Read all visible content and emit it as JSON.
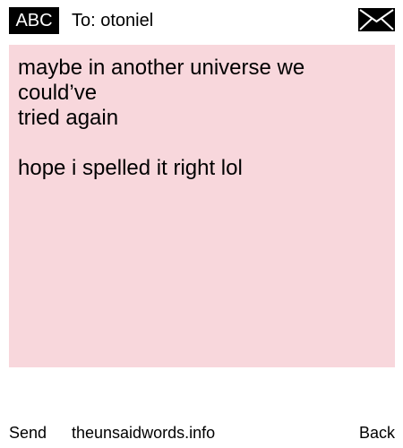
{
  "header": {
    "keyboard_mode_label": "ABC",
    "to_line": "To: otoniel",
    "mail_icon": "envelope-icon"
  },
  "message": {
    "text": "maybe in another universe we could’ve\ntried again\n\nhope i spelled it right lol",
    "background_color": "#f8d7dc"
  },
  "footer": {
    "send_label": "Send",
    "site_label": "theunsaidwords.info",
    "back_label": "Back"
  }
}
